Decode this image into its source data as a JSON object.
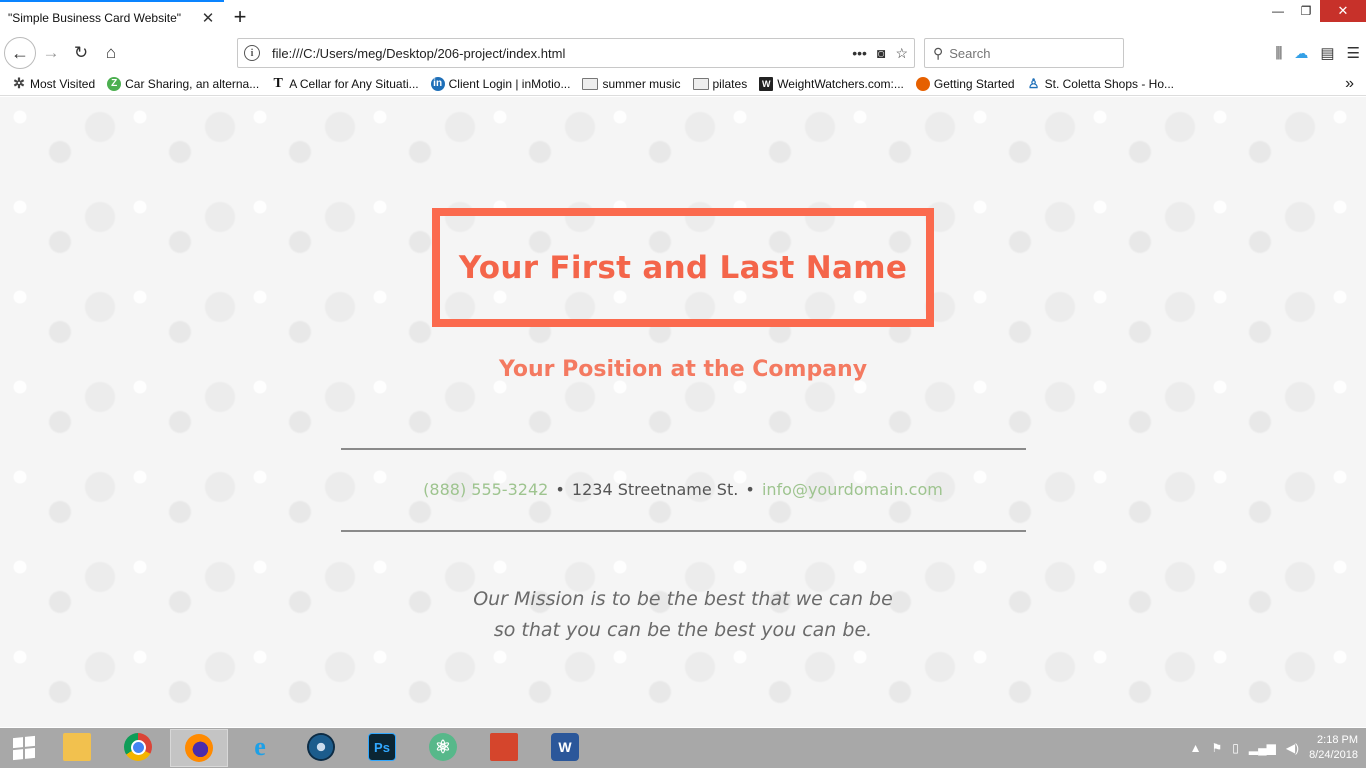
{
  "browser": {
    "tab_title": "\"Simple Business Card Website\"",
    "tab_close_icon": "close-icon",
    "new_tab_symbol": "+",
    "url": "file:///C:/Users/meg/Desktop/206-project/index.html",
    "search_placeholder": "Search",
    "window_controls": {
      "minimize": "—",
      "restore": "❐",
      "close": "✕"
    }
  },
  "bookmarks": [
    {
      "label": "Most Visited",
      "icon": "gear-icon"
    },
    {
      "label": "Car Sharing, an alterna...",
      "icon": "zipcar-icon"
    },
    {
      "label": "A Cellar for Any Situati...",
      "icon": "nyt-icon"
    },
    {
      "label": "Client Login | inMotio...",
      "icon": "inmotion-icon"
    },
    {
      "label": "summer music",
      "icon": "folder-icon"
    },
    {
      "label": "pilates",
      "icon": "folder-icon"
    },
    {
      "label": "WeightWatchers.com:...",
      "icon": "ww-icon"
    },
    {
      "label": "Getting Started",
      "icon": "firefox-icon"
    },
    {
      "label": "St. Coletta Shops - Ho...",
      "icon": "stcoletta-icon"
    }
  ],
  "card": {
    "name": "Your First and Last Name",
    "position": "Your Position at the Company",
    "phone": "(888) 555-3242",
    "address": "1234 Streetname St.",
    "email": "info@yourdomain.com",
    "separator": "•",
    "mission_line1": "Our Mission is to be the best that we can be",
    "mission_line2": "so that you can be the best you can be."
  },
  "colors": {
    "accent_border": "#fb6a4e",
    "name_text": "#f4654a",
    "position_text": "#f47a61",
    "link_green": "#9ec48f"
  },
  "taskbar": {
    "apps": [
      "file-explorer-icon",
      "chrome-icon",
      "firefox-icon",
      "internet-explorer-icon",
      "media-disc-icon",
      "photoshop-icon",
      "atom-icon",
      "red-app-icon",
      "word-icon"
    ],
    "ps_label": "Ps",
    "word_label": "W",
    "time": "2:18 PM",
    "date": "8/24/2018"
  }
}
